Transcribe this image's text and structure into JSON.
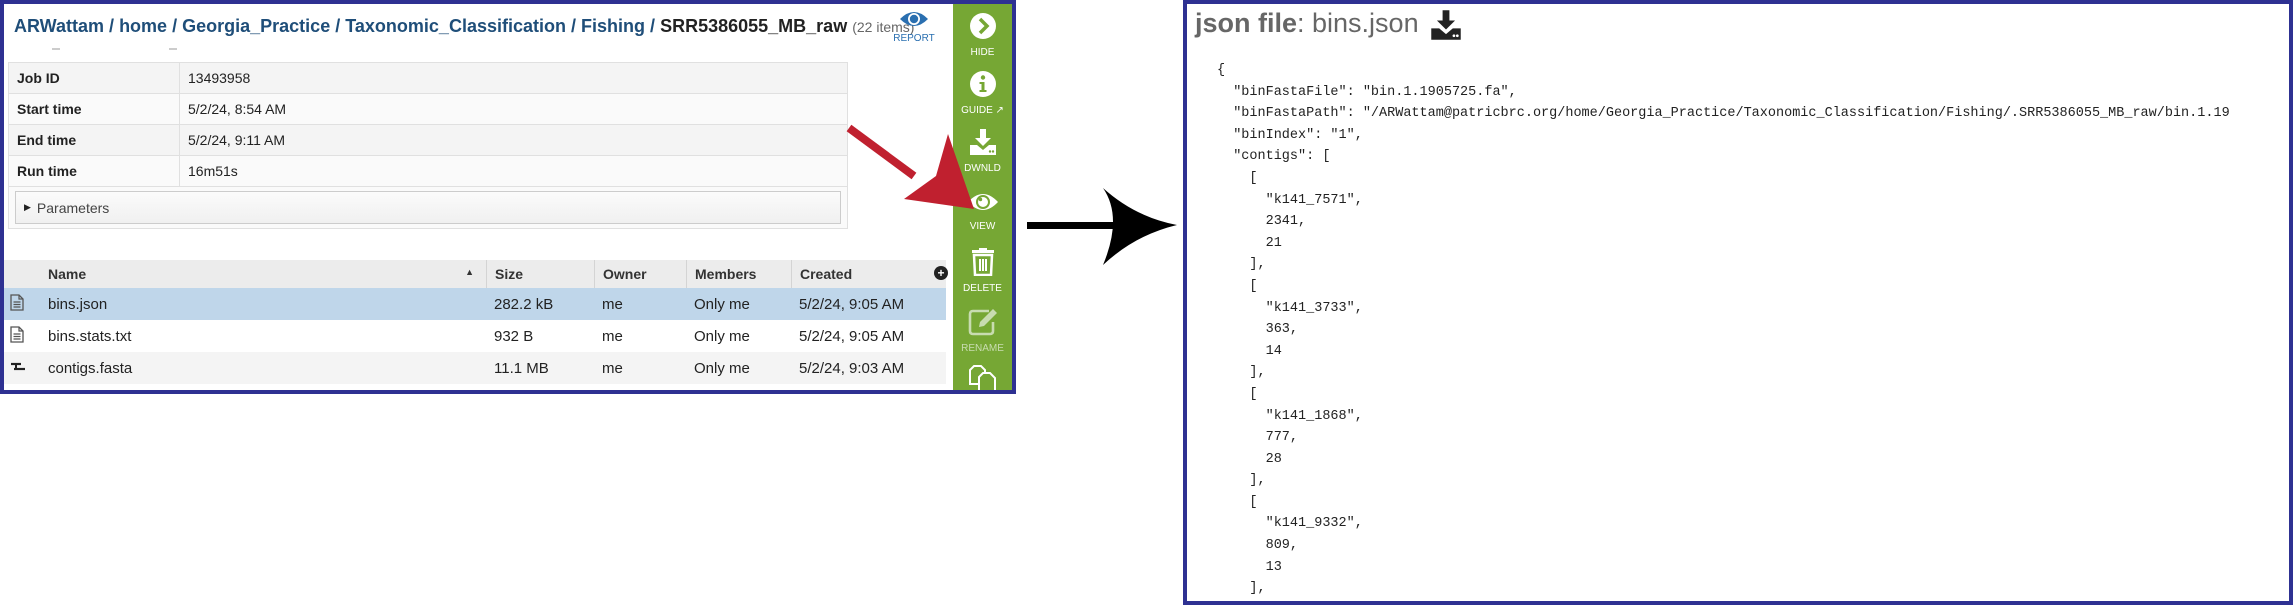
{
  "left": {
    "breadcrumb": {
      "parts": [
        "ARWattam",
        "home",
        "Georgia_Practice",
        "Taxonomic_Classification",
        "Fishing"
      ],
      "separator": "/",
      "current": "SRR5386055_MB_raw",
      "count": "(22 items)"
    },
    "report_label": "REPORT",
    "job_meta": [
      {
        "key": "Job ID",
        "value": "13493958"
      },
      {
        "key": "Start time",
        "value": "5/2/24, 8:54 AM"
      },
      {
        "key": "End time",
        "value": "5/2/24, 9:11 AM"
      },
      {
        "key": "Run time",
        "value": "16m51s"
      }
    ],
    "parameters_label": "Parameters",
    "grid": {
      "columns": [
        "Name",
        "Size",
        "Owner",
        "Members",
        "Created"
      ],
      "rows": [
        {
          "icon": "file-text-icon",
          "name": "bins.json",
          "size": "282.2 kB",
          "owner": "me",
          "members": "Only me",
          "created": "5/2/24, 9:05 AM",
          "selected": true
        },
        {
          "icon": "file-text-icon",
          "name": "bins.stats.txt",
          "size": "932 B",
          "owner": "me",
          "members": "Only me",
          "created": "5/2/24, 9:05 AM",
          "selected": false
        },
        {
          "icon": "contigs-icon",
          "name": "contigs.fasta",
          "size": "11.1 MB",
          "owner": "me",
          "members": "Only me",
          "created": "5/2/24, 9:03 AM",
          "selected": false
        }
      ]
    },
    "actions": [
      {
        "id": "hide",
        "label": "HIDE",
        "icon": "chevron-right-circle-icon"
      },
      {
        "id": "guide",
        "label": "GUIDE",
        "icon": "info-circle-icon"
      },
      {
        "id": "download",
        "label": "DWNLD",
        "icon": "download-icon"
      },
      {
        "id": "view",
        "label": "VIEW",
        "icon": "eye-icon"
      },
      {
        "id": "delete",
        "label": "DELETE",
        "icon": "trash-icon"
      },
      {
        "id": "rename",
        "label": "RENAME",
        "icon": "edit-icon",
        "disabled": true
      },
      {
        "id": "copy",
        "label": "",
        "icon": "copy-icon"
      }
    ],
    "colors": {
      "action_bar": "#76a734",
      "selected_row": "#bfd6ea",
      "breadcrumb": "#1f4e79",
      "annotation_arrow": "#c0202f",
      "frame": "#2e3192"
    }
  },
  "right": {
    "title_bold": "json file",
    "title_rest": ": bins.json",
    "json_lines": [
      "{",
      "  \"binFastaFile\": \"bin.1.1905725.fa\",",
      "  \"binFastaPath\": \"/ARWattam@patricbrc.org/home/Georgia_Practice/Taxonomic_Classification/Fishing/.SRR5386055_MB_raw/bin.1.19",
      "  \"binIndex\": \"1\",",
      "  \"contigs\": [",
      "    [",
      "      \"k141_7571\",",
      "      2341,",
      "      21",
      "    ],",
      "    [",
      "      \"k141_3733\",",
      "      363,",
      "      14",
      "    ],",
      "    [",
      "      \"k141_1868\",",
      "      777,",
      "      28",
      "    ],",
      "    [",
      "      \"k141_9332\",",
      "      809,",
      "      13",
      "    ],"
    ]
  }
}
